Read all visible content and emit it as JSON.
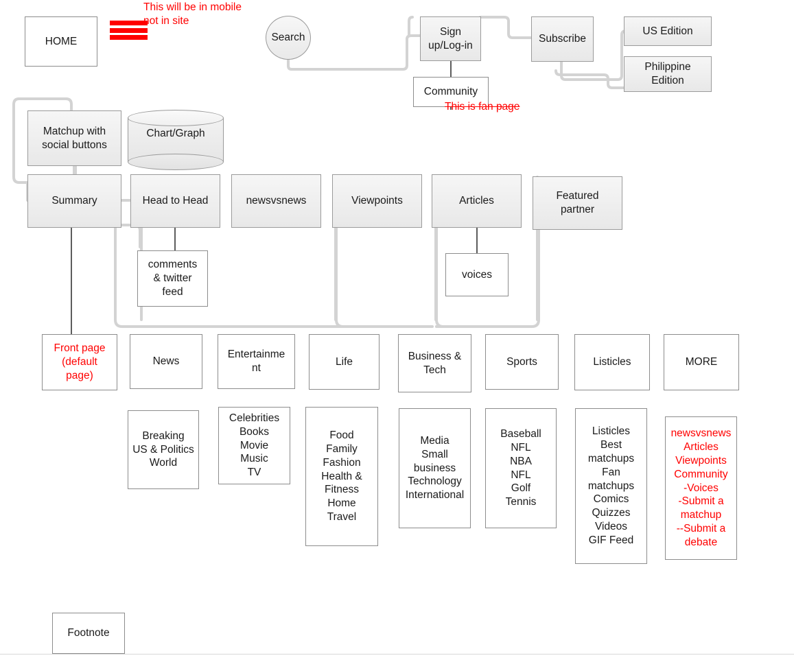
{
  "diagram": {
    "title": "Website sitemap flowchart",
    "colors": {
      "annotation_red": "#ff0000",
      "node_border": "#888888",
      "connector_gray": "#d0d0d0",
      "connector_dark": "#3a3a3a",
      "shaded_fill": "#ececec"
    }
  },
  "nodes": {
    "home": "HOME",
    "search": "Search",
    "signup": "Sign\nup/Log-in",
    "subscribe": "Subscribe",
    "us_edition": "US Edition",
    "philippine_edition": "Philippine\nEdition",
    "community": "Community",
    "matchup": "Matchup with\nsocial buttons",
    "chart_graph": "Chart/Graph",
    "summary": "Summary",
    "head_to_head": "Head to Head",
    "newsvsnews": "newsvsnews",
    "viewpoints": "Viewpoints",
    "articles": "Articles",
    "featured_partner": "Featured\npartner",
    "comments_twitter": "comments\n& twitter\nfeed",
    "voices": "voices",
    "footnote": "Footnote"
  },
  "annotations": {
    "mobile_note": "This will be in mobile\nnot in site",
    "fan_page_note": "This is fan page"
  },
  "icons": {
    "hamburger": "hamburger-menu-icon"
  },
  "categories": [
    {
      "key": "front_page",
      "label": "Front page\n(default\npage)",
      "red": true,
      "sub": null
    },
    {
      "key": "news",
      "label": "News",
      "red": false,
      "sub": "Breaking\nUS & Politics\nWorld"
    },
    {
      "key": "entertainment",
      "label": "Entertainme\nnt",
      "red": false,
      "sub": "Celebrities\nBooks\nMovie\nMusic\nTV"
    },
    {
      "key": "life",
      "label": "Life",
      "red": false,
      "sub": "Food\nFamily\nFashion\nHealth &\nFitness\nHome\nTravel"
    },
    {
      "key": "business_tech",
      "label": "Business &\nTech",
      "red": false,
      "sub": "Media\nSmall\nbusiness\nTechnology\nInternational"
    },
    {
      "key": "sports",
      "label": "Sports",
      "red": false,
      "sub": "Baseball\nNFL\nNBA\nNFL\nGolf\nTennis"
    },
    {
      "key": "listicles",
      "label": "Listicles",
      "red": false,
      "sub": "Listicles\nBest\nmatchups\nFan\nmatchups\nComics\nQuizzes\nVideos\nGIF Feed"
    },
    {
      "key": "more",
      "label": "MORE",
      "red": false,
      "sub": "newsvsnews\nArticles\nViewpoints\nCommunity\n-Voices\n-Submit a\nmatchup\n--Submit a\ndebate",
      "sub_red": true
    }
  ]
}
